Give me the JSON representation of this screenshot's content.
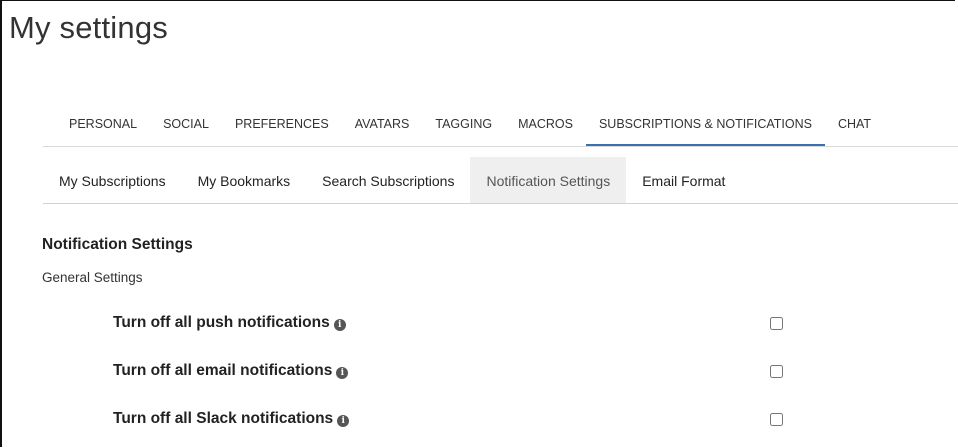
{
  "page": {
    "title": "My settings"
  },
  "top_tabs": [
    {
      "label": "PERSONAL"
    },
    {
      "label": "SOCIAL"
    },
    {
      "label": "PREFERENCES"
    },
    {
      "label": "AVATARS"
    },
    {
      "label": "TAGGING"
    },
    {
      "label": "MACROS"
    },
    {
      "label": "SUBSCRIPTIONS & NOTIFICATIONS",
      "active": true
    },
    {
      "label": "CHAT"
    }
  ],
  "sub_tabs": [
    {
      "label": "My Subscriptions"
    },
    {
      "label": "My Bookmarks"
    },
    {
      "label": "Search Subscriptions"
    },
    {
      "label": "Notification Settings",
      "active": true
    },
    {
      "label": "Email Format"
    }
  ],
  "notification_settings": {
    "title": "Notification Settings",
    "subtitle": "General Settings",
    "items": [
      {
        "label": "Turn off all push notifications",
        "icon": "info-icon",
        "checked": false
      },
      {
        "label": "Turn off all email notifications",
        "icon": "info-icon",
        "checked": false
      },
      {
        "label": "Turn off all Slack notifications",
        "icon": "info-icon",
        "checked": false
      }
    ]
  },
  "colors": {
    "active_tab_underline": "#3b6fb0",
    "active_subtab_bg": "#efefef"
  }
}
